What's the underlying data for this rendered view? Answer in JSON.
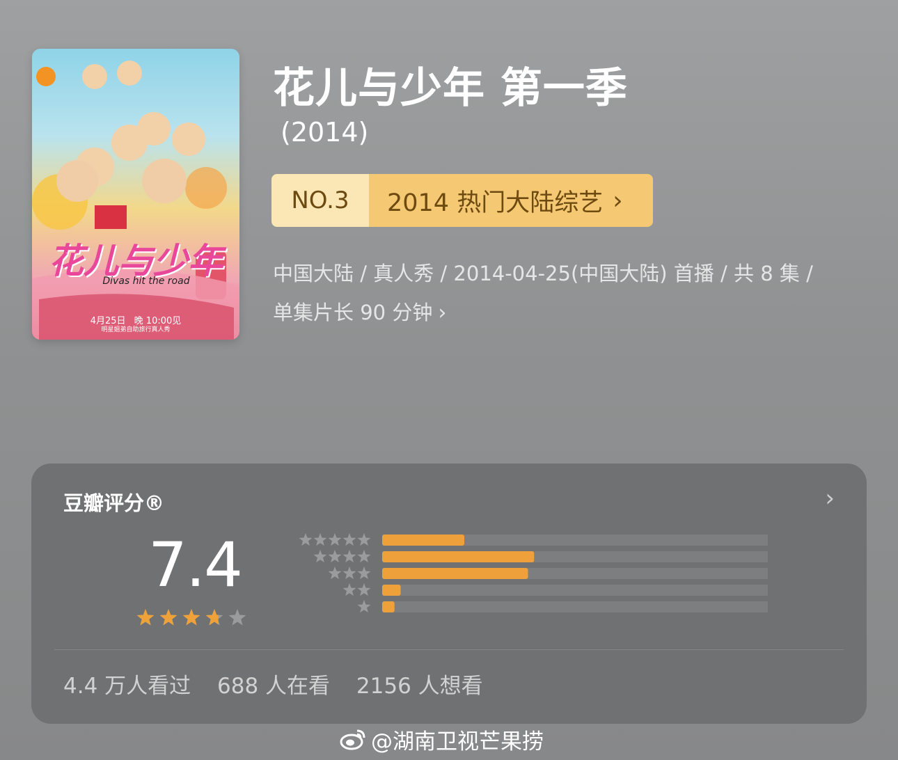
{
  "poster": {
    "title_art": "花儿与少年",
    "subtitle_art": "Divas hit the road",
    "air_date": "4月25日",
    "air_time": "晚 10:00见",
    "tagline": "明星姐弟自助旅行真人秀"
  },
  "show": {
    "title": "花儿与少年 第一季",
    "year": "(2014)"
  },
  "ranking": {
    "number": "NO.3",
    "label": "2014 热门大陆综艺",
    "chevron": "›"
  },
  "meta": {
    "line1": "中国大陆 / 真人秀 / 2014-04-25(中国大陆) 首播 / 共 8 集 /",
    "line2": "单集片长 90 分钟",
    "chevron": "›"
  },
  "rating": {
    "title": "豆瓣评分®",
    "chevron": "›",
    "score": "7.4",
    "stars_value": 3.7,
    "stars_max": 5,
    "distribution": [
      {
        "stars": 5,
        "fraction": 0.2
      },
      {
        "stars": 4,
        "fraction": 0.37
      },
      {
        "stars": 3,
        "fraction": 0.355
      },
      {
        "stars": 2,
        "fraction": 0.045
      },
      {
        "stars": 1,
        "fraction": 0.03
      }
    ],
    "stats": {
      "seen": "4.4 万人看过",
      "watching": "688 人在看",
      "wish": "2156 人想看"
    }
  },
  "colors": {
    "bar_fill": "#eea13a",
    "bar_track": "#7d7e7f",
    "star_active": "#f0a23a",
    "star_inactive": "#9a9b9c",
    "rank_left_bg": "#fbe7b6",
    "rank_right_bg": "#f5c873"
  },
  "watermark": {
    "text": "@湖南卫视芒果捞"
  }
}
